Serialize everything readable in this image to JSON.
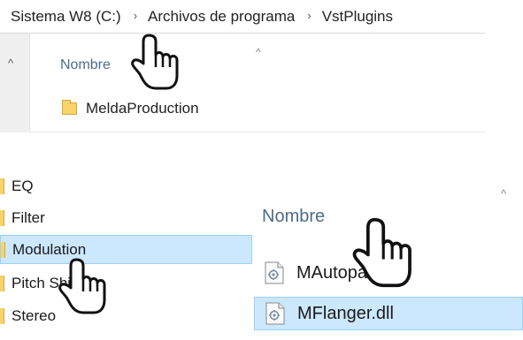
{
  "breadcrumb": {
    "items": [
      "Sistema W8 (C:)",
      "Archivos de programa",
      "VstPlugins"
    ],
    "separator": "›"
  },
  "top_list": {
    "column_header": "Nombre",
    "rows": [
      "MeldaProduction"
    ]
  },
  "folder_tree": {
    "items": [
      "EQ",
      "Filter",
      "Modulation",
      "Pitch Shift",
      "Stereo"
    ],
    "selected": "Modulation"
  },
  "file_list": {
    "column_header": "Nombre",
    "rows": [
      "MAutopan.dll",
      "MFlanger.dll"
    ],
    "selected": "MFlanger.dll"
  },
  "colors": {
    "selection_fill": "#cce8ff",
    "selection_border": "#99d1ff",
    "header_text": "#4d6b8a",
    "folder_yellow": "#f6d36b"
  },
  "icons": {
    "cursor": "hand-pointer-icon",
    "folder": "folder-icon",
    "file": "dll-file-icon",
    "sort": "chevron-up-icon",
    "scroll": "scroll-up-icon"
  }
}
